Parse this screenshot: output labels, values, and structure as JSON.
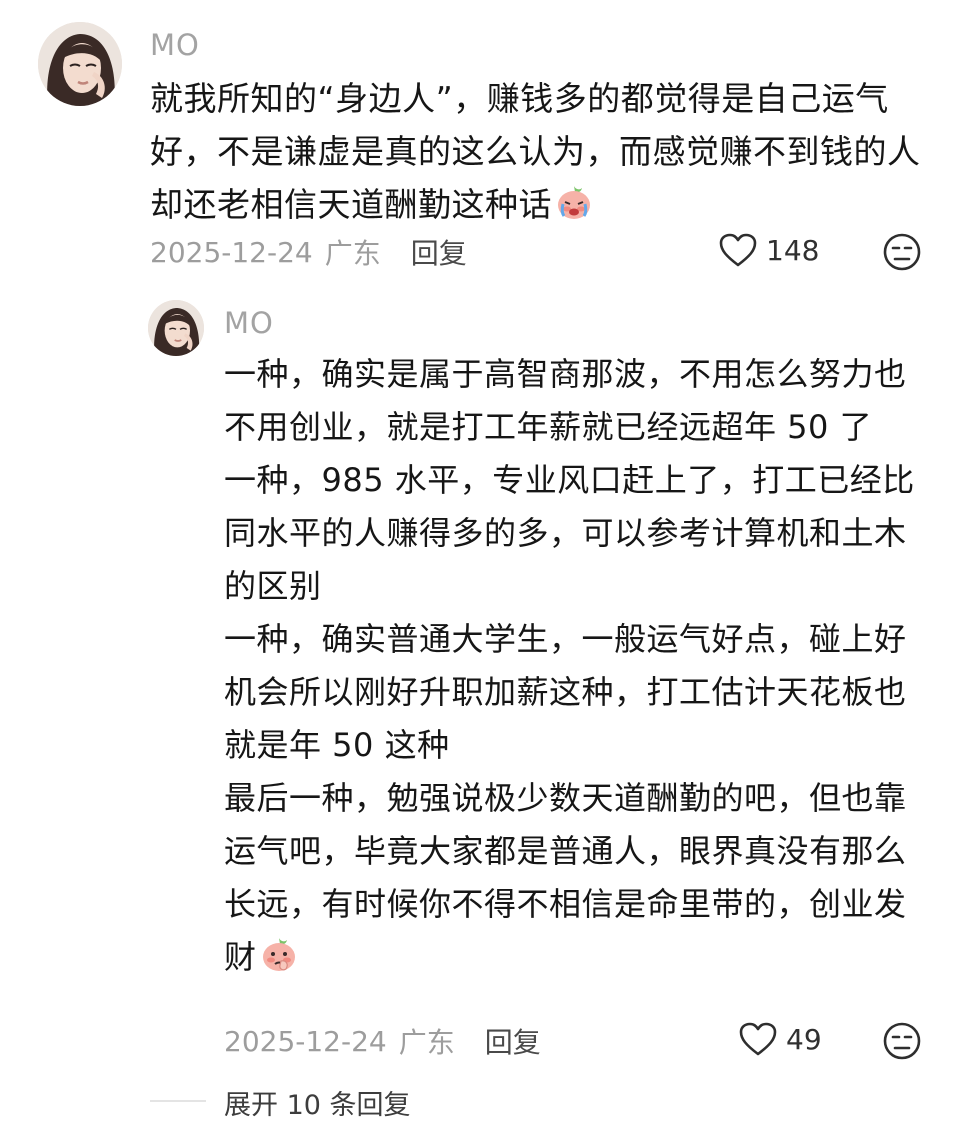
{
  "top_comment": {
    "username": "MO",
    "text_lines": [
      "就我所知的“身边人”，赚钱多的都觉得是自己运气",
      "好，不是谦虚是真的这么认为，而感觉赚不到钱的人",
      "却还老相信天道酬勤这种话"
    ],
    "emoji_icon": "crying-peach-emoji",
    "date": "2025-12-24",
    "location": "广东",
    "reply_label": "回复",
    "like_count": "148"
  },
  "reply_comment": {
    "username": "MO",
    "text_lines": [
      "一种，确实是属于高智商那波，不用怎么努力也",
      "不用创业，就是打工年薪就已经远超年 50 了",
      "一种，985 水平，专业风口赶上了，打工已经比",
      "同水平的人赚得多的多，可以参考计算机和土木",
      "的区别",
      "一种，确实普通大学生，一般运气好点，碰上好",
      "机会所以刚好升职加薪这种，打工估计天花板也",
      "就是年 50 这种",
      "最后一种，勉强说极少数天道酬勤的吧，但也靠",
      "运气吧，毕竟大家都是普通人，眼界真没有那么",
      "长远，有时候你不得不相信是命里带的，创业发",
      "财"
    ],
    "emoji_icon": "thinking-peach-emoji",
    "date": "2025-12-24",
    "location": "广东",
    "reply_label": "回复",
    "like_count": "49"
  },
  "expand_replies_label": "展开 10 条回复",
  "colors": {
    "text": "#161616",
    "meta": "#9d9d9d",
    "username": "#a3a3a3",
    "emoji_peach": "#f5b3ab"
  }
}
